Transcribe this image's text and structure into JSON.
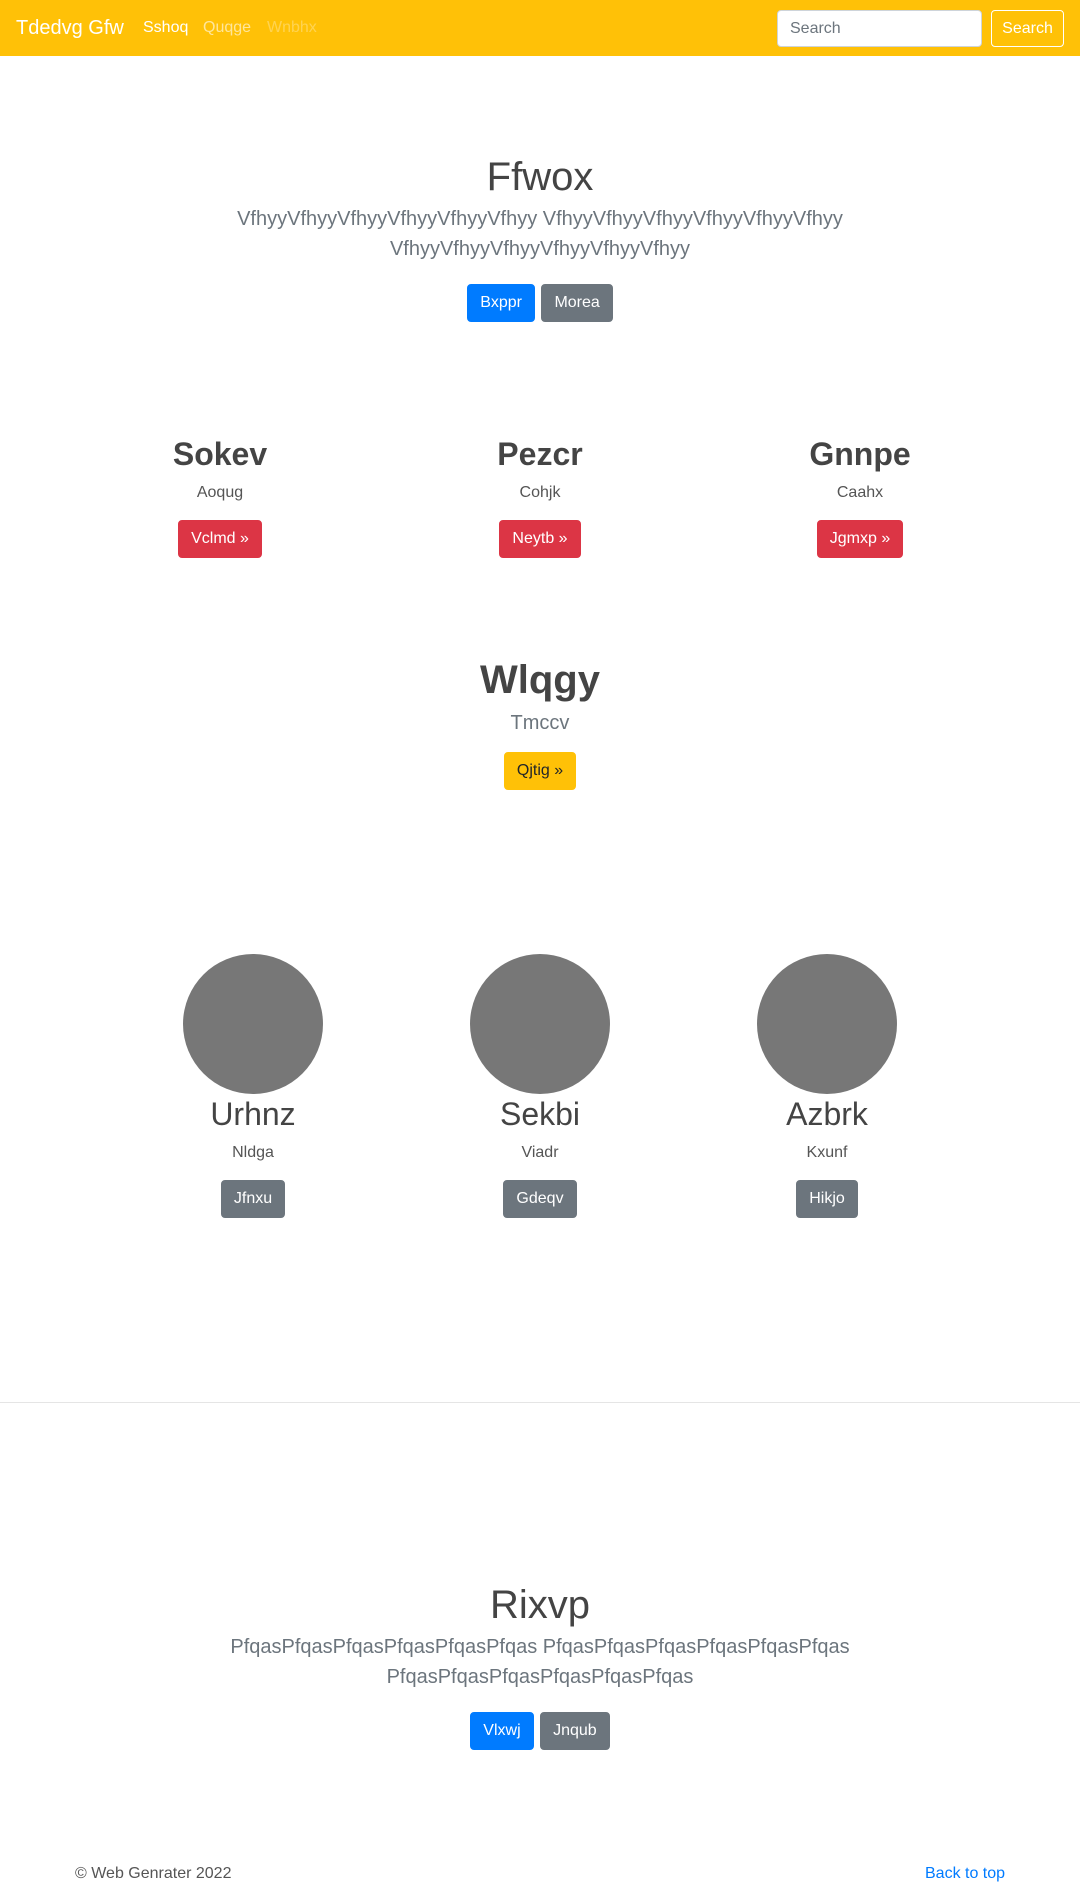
{
  "navbar": {
    "brand": "Tdedvg Gfw",
    "links": [
      "Sshoq",
      "Quqge",
      "Wnbhx"
    ],
    "search_placeholder": "Search",
    "search_button": "Search",
    "colors": {
      "background": "#ffc107"
    }
  },
  "hero": {
    "title": "Ffwox",
    "lead_line1": "VfhyyVfhyyVfhyyVfhyyVfhyyVfhyy VfhyyVfhyyVfhyyVfhyyVfhyyVfhyy",
    "lead_line2": "VfhyyVfhyyVfhyyVfhyyVfhyyVfhyy",
    "primary_button": "Bxppr",
    "secondary_button": "Morea"
  },
  "features": [
    {
      "title": "Sokev",
      "subtitle": "Aoqug",
      "button": "Vclmd »"
    },
    {
      "title": "Pezcr",
      "subtitle": "Cohjk",
      "button": "Neytb »"
    },
    {
      "title": "Gnnpe",
      "subtitle": "Caahx",
      "button": "Jgmxp »"
    }
  ],
  "highlight": {
    "title": "Wlqgy",
    "subtitle": "Tmccv",
    "button": "Qjtig »"
  },
  "team": [
    {
      "name": "Urhnz",
      "role": "Nldga",
      "button": "Jfnxu"
    },
    {
      "name": "Sekbi",
      "role": "Viadr",
      "button": "Gdeqv"
    },
    {
      "name": "Azbrk",
      "role": "Kxunf",
      "button": "Hikjo"
    }
  ],
  "cta": {
    "title": "Rixvp",
    "lead_line1": "PfqasPfqasPfqasPfqasPfqasPfqas PfqasPfqasPfqasPfqasPfqasPfqas",
    "lead_line2": "PfqasPfqasPfqasPfqasPfqasPfqas",
    "primary_button": "Vlxwj",
    "secondary_button": "Jnqub"
  },
  "footer": {
    "copyright": "© Web Genrater 2022",
    "back_to_top": "Back to top"
  }
}
